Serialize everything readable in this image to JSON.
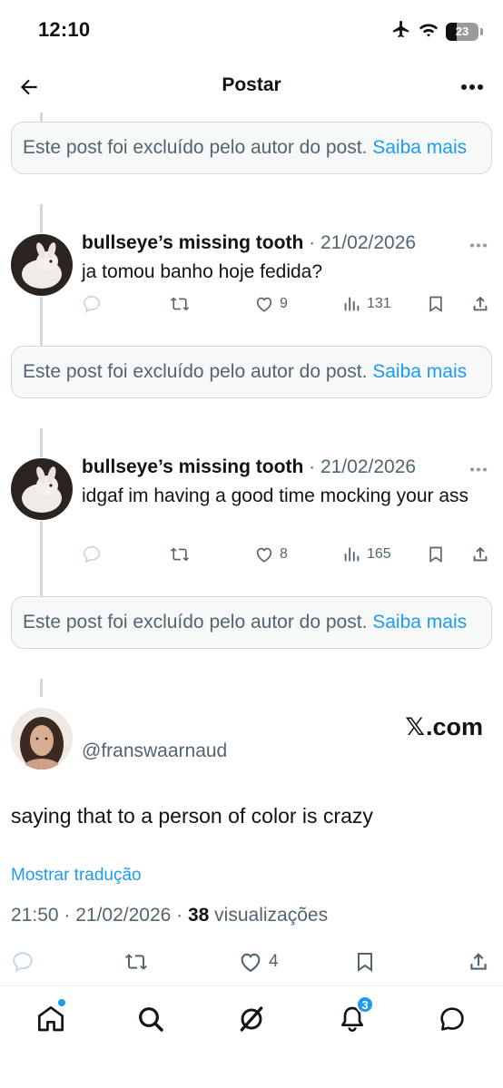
{
  "status_bar": {
    "time": "12:10",
    "battery": "23"
  },
  "header": {
    "title": "Postar"
  },
  "deleted_notice": {
    "text": "Este post foi excluído pelo autor do post. ",
    "link": "Saiba mais"
  },
  "replies": [
    {
      "name": "bullseye’s missing tooth",
      "separator": " · ",
      "date": "21/02/2026",
      "text": "ja tomou banho hoje fedida?",
      "likes": "9",
      "views": "131"
    },
    {
      "name": "bullseye’s missing tooth",
      "separator": " · ",
      "date": "21/02/2026",
      "text": "idgaf im having a good time mocking your ass",
      "likes": "8",
      "views": "165"
    }
  ],
  "main_post": {
    "handle": "@franswaarnaud",
    "watermark_x": "𝕏",
    "watermark_domain": ".com",
    "text": "saying that to a person of color is crazy",
    "translate_label": "Mostrar tradução",
    "time_date": "21:50 · 21/02/2026 · ",
    "views_count": "38",
    "views_label": " visualizações",
    "likes": "4"
  },
  "bottom_nav": {
    "notifications_badge": "3"
  },
  "colors": {
    "accent": "#1d9bf0",
    "secondary_text": "#536471",
    "thread_line": "#cfd9de"
  }
}
